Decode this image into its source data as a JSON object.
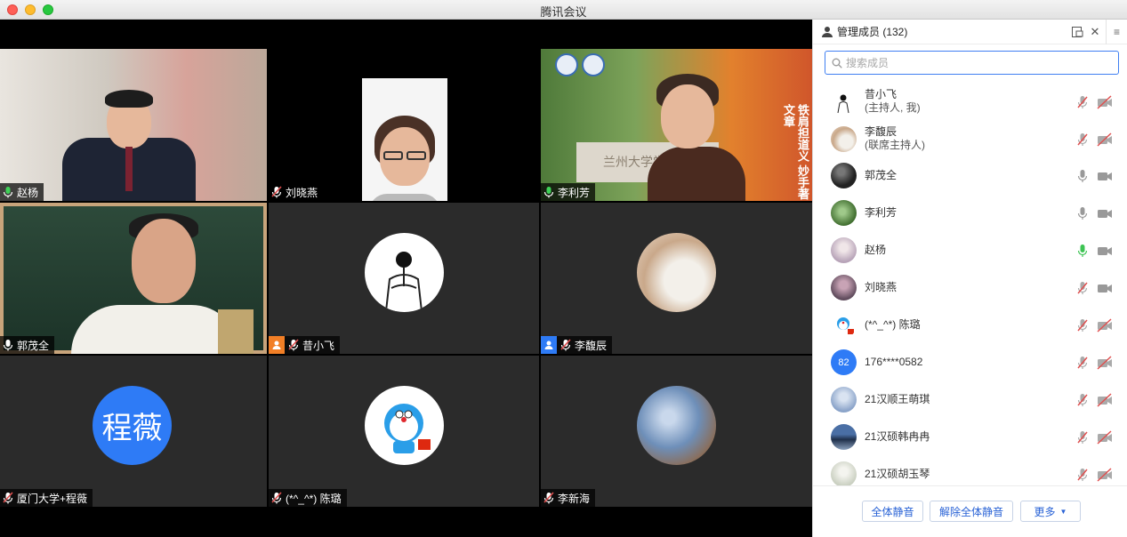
{
  "window": {
    "title": "腾讯会议"
  },
  "tiles": {
    "zhaoyang": {
      "name": "赵杨"
    },
    "liuxiaoyan": {
      "name": "刘晓燕"
    },
    "lilifang": {
      "name": "李利芳",
      "sign_text": "兰州大学学",
      "calligraphy": "铁肩担道义 妙手著文章"
    },
    "guomaoquan": {
      "name": "郭茂全"
    },
    "xixiaofei": {
      "name": "昔小飞"
    },
    "lifuchen": {
      "name": "李馥辰"
    },
    "chengwei": {
      "name": "厦门大学+程薇",
      "avatar_text": "程薇"
    },
    "chenlu": {
      "name": "(*^_^*) 陈璐"
    },
    "lixinhai": {
      "name": "李新海"
    }
  },
  "panel": {
    "title": "管理成员 (132)",
    "search_placeholder": "搜索成员",
    "members": [
      {
        "name": "昔小飞",
        "sub": "(主持人, 我)",
        "mic": "muted",
        "cam": "off"
      },
      {
        "name": "李馥辰",
        "sub": "(联席主持人)",
        "mic": "muted",
        "cam": "off"
      },
      {
        "name": "郭茂全",
        "sub": "",
        "mic": "on",
        "cam": "on"
      },
      {
        "name": "李利芳",
        "sub": "",
        "mic": "on",
        "cam": "on"
      },
      {
        "name": "赵杨",
        "sub": "",
        "mic": "active",
        "cam": "on"
      },
      {
        "name": "刘晓燕",
        "sub": "",
        "mic": "muted",
        "cam": "on"
      },
      {
        "name": "(*^_^*) 陈璐",
        "sub": "",
        "mic": "muted",
        "cam": "off"
      },
      {
        "name": "176****0582",
        "sub": "",
        "avatar_text": "82",
        "mic": "muted",
        "cam": "off"
      },
      {
        "name": "21汉顺王萌琪",
        "sub": "",
        "mic": "muted",
        "cam": "off"
      },
      {
        "name": "21汉硕韩冉冉",
        "sub": "",
        "mic": "muted",
        "cam": "off"
      },
      {
        "name": "21汉硕胡玉琴",
        "sub": "",
        "mic": "muted",
        "cam": "off"
      }
    ],
    "footer": {
      "mute_all": "全体静音",
      "unmute_all": "解除全体静音",
      "more": "更多"
    }
  },
  "colors": {
    "accent": "#2e7bf6",
    "speaking": "#2fb344",
    "muted": "#e05050"
  }
}
